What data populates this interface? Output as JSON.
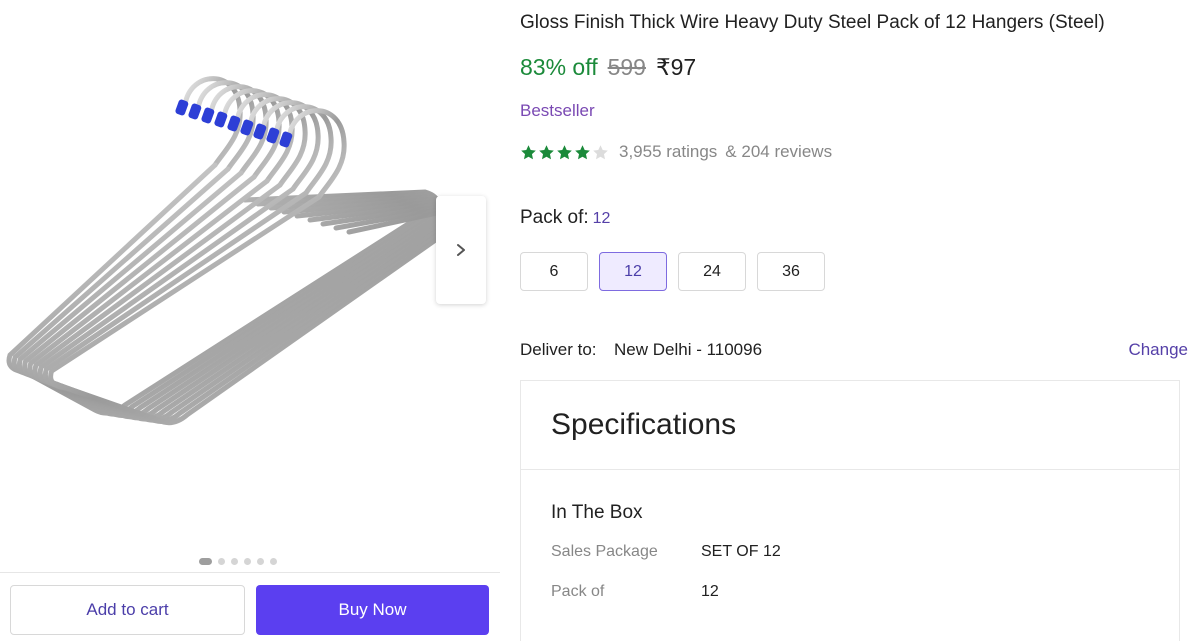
{
  "product": {
    "title": "Gloss Finish Thick Wire Heavy Duty Steel Pack of 12 Hangers (Steel)",
    "discount": "83% off",
    "mrp": "599",
    "price": "₹97",
    "badge": "Bestseller",
    "rating": {
      "stars_filled": 4,
      "stars_total": 5,
      "ratings_text": "3,955 ratings",
      "reviews_text": "& 204 reviews"
    }
  },
  "colors": {
    "primary": "#5b3ff0",
    "discount_green": "#1b8a3a",
    "star_green": "#1b8a3a",
    "link": "#5540a8"
  },
  "gallery": {
    "image_count": 6,
    "active_index": 0,
    "image_icon": "steel-hangers-image"
  },
  "pack": {
    "label": "Pack of:",
    "selected": "12",
    "options": [
      "6",
      "12",
      "24",
      "36"
    ]
  },
  "delivery": {
    "label": "Deliver to:",
    "location": "New Delhi - 110096",
    "change_label": "Change"
  },
  "specifications": {
    "title": "Specifications",
    "group_title": "In The Box",
    "rows": [
      {
        "key": "Sales Package",
        "value": "SET OF 12"
      },
      {
        "key": "Pack of",
        "value": "12"
      }
    ]
  },
  "actions": {
    "add_to_cart": "Add to cart",
    "buy_now": "Buy Now"
  }
}
